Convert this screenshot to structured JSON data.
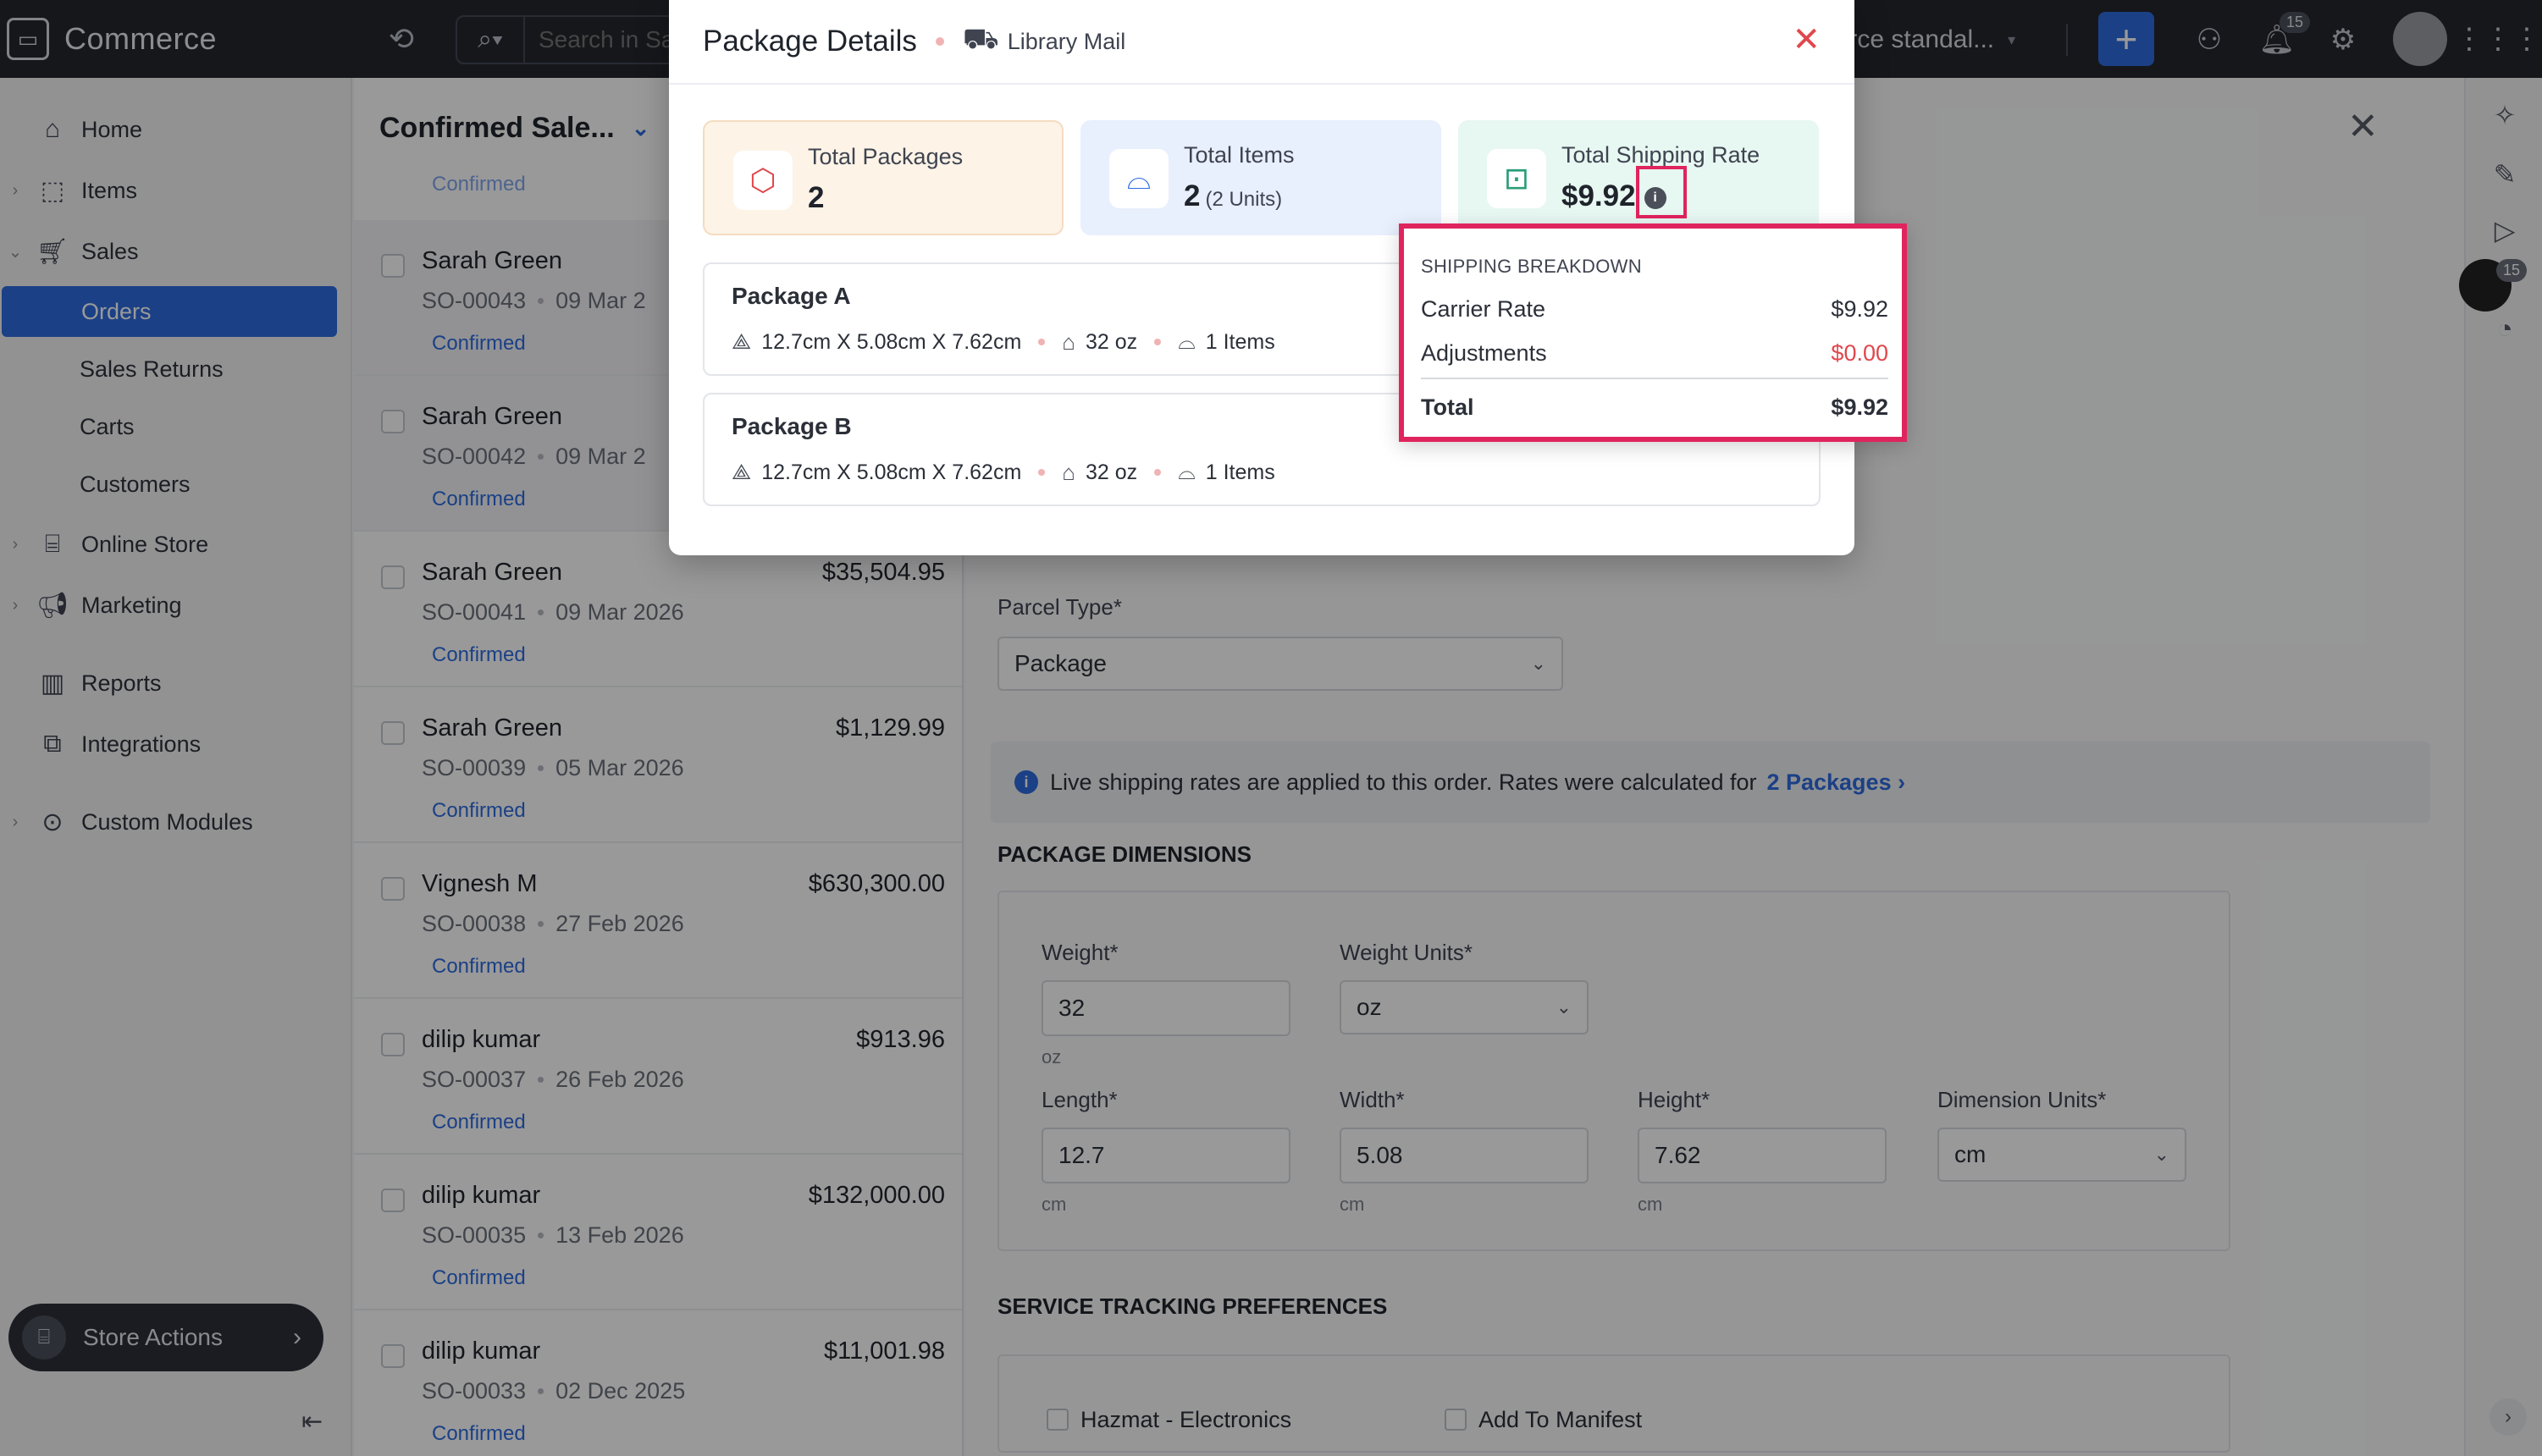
{
  "app": {
    "name": "Commerce",
    "search_placeholder": "Search in Sa",
    "org_name": "nerce standal...",
    "notification_count": "15"
  },
  "sidebar": {
    "items": [
      {
        "label": "Home"
      },
      {
        "label": "Items"
      },
      {
        "label": "Sales"
      },
      {
        "label": "Orders"
      },
      {
        "label": "Sales Returns"
      },
      {
        "label": "Carts"
      },
      {
        "label": "Customers"
      },
      {
        "label": "Online Store"
      },
      {
        "label": "Marketing"
      },
      {
        "label": "Reports"
      },
      {
        "label": "Integrations"
      },
      {
        "label": "Custom Modules"
      }
    ],
    "store_actions": "Store Actions"
  },
  "list": {
    "title": "Confirmed Sale...",
    "partial_status": "Confirmed",
    "rows": [
      {
        "name": "Sarah Green",
        "amount": "",
        "number": "SO-00043",
        "date": "09 Mar 2",
        "status": "Confirmed"
      },
      {
        "name": "Sarah Green",
        "amount": "",
        "number": "SO-00042",
        "date": "09 Mar 2",
        "status": "Confirmed"
      },
      {
        "name": "Sarah Green",
        "amount": "$35,504.95",
        "number": "SO-00041",
        "date": "09 Mar 2026",
        "status": "Confirmed"
      },
      {
        "name": "Sarah Green",
        "amount": "$1,129.99",
        "number": "SO-00039",
        "date": "05 Mar 2026",
        "status": "Confirmed"
      },
      {
        "name": "Vignesh M",
        "amount": "$630,300.00",
        "number": "SO-00038",
        "date": "27 Feb 2026",
        "status": "Confirmed"
      },
      {
        "name": "dilip kumar",
        "amount": "$913.96",
        "number": "SO-00037",
        "date": "26 Feb 2026",
        "status": "Confirmed"
      },
      {
        "name": "dilip kumar",
        "amount": "$132,000.00",
        "number": "SO-00035",
        "date": "13 Feb 2026",
        "status": "Confirmed"
      },
      {
        "name": "dilip kumar",
        "amount": "$11,001.98",
        "number": "SO-00033",
        "date": "02 Dec 2025",
        "status": "Confirmed"
      }
    ]
  },
  "detail": {
    "parcel_type_label": "Parcel Type*",
    "parcel_type_value": "Package",
    "banner_text": "Live shipping rates are applied to this order. Rates were calculated for",
    "banner_link": "2 Packages",
    "dims_title": "PACKAGE DIMENSIONS",
    "weight_label": "Weight*",
    "weight_value": "32",
    "weight_hint": "oz",
    "weight_units_label": "Weight Units*",
    "weight_units_value": "oz",
    "length_label": "Length*",
    "length_value": "12.7",
    "width_label": "Width*",
    "width_value": "5.08",
    "height_label": "Height*",
    "height_value": "7.62",
    "dim_units_label": "Dimension Units*",
    "dim_units_value": "cm",
    "dim_hint": "cm",
    "tracking_title": "SERVICE TRACKING PREFERENCES",
    "hazmat_label": "Hazmat - Electronics",
    "manifest_label": "Add To Manifest"
  },
  "modal": {
    "title": "Package Details",
    "carrier": "Library Mail",
    "stats": [
      {
        "label": "Total Packages",
        "value": "2",
        "sub": ""
      },
      {
        "label": "Total Items",
        "value": "2",
        "sub": "(2 Units)"
      },
      {
        "label": "Total Shipping Rate",
        "value": "$9.92",
        "sub": ""
      }
    ],
    "packages": [
      {
        "name": "Package A",
        "dims": "12.7cm X 5.08cm X 7.62cm",
        "weight": "32 oz",
        "items": "1 Items"
      },
      {
        "name": "Package B",
        "dims": "12.7cm X 5.08cm X 7.62cm",
        "weight": "32 oz",
        "items": "1 Items"
      }
    ],
    "breakdown": {
      "title": "SHIPPING BREAKDOWN",
      "carrier_rate_label": "Carrier Rate",
      "carrier_rate_value": "$9.92",
      "adjustments_label": "Adjustments",
      "adjustments_value": "$0.00",
      "total_label": "Total",
      "total_value": "$9.92"
    }
  },
  "colors": {
    "accent": "#2d6cdf",
    "highlight": "#e0245e",
    "topbar": "#24272e",
    "packages_card": "#fdf3e7",
    "items_card": "#e8effd",
    "rate_card": "#e7f7f1"
  },
  "rail": {
    "badge": "15"
  }
}
